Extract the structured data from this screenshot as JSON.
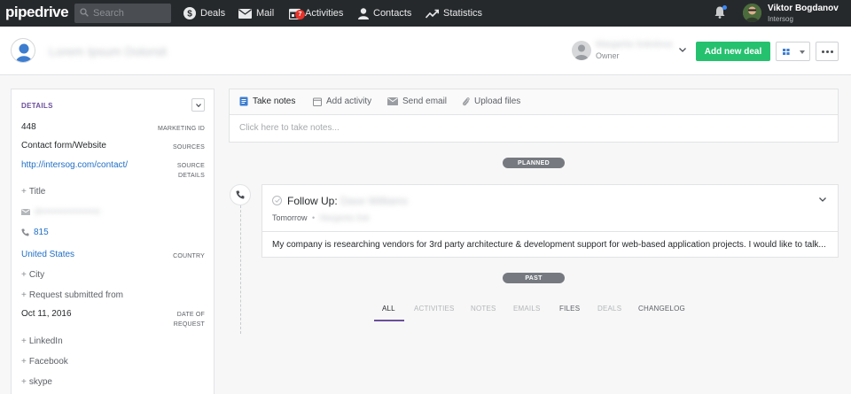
{
  "app": {
    "logo": "pipedrive",
    "search_placeholder": "Search"
  },
  "nav": [
    {
      "label": "Deals",
      "icon": "dollar-icon"
    },
    {
      "label": "Mail",
      "icon": "mail-icon"
    },
    {
      "label": "Activities",
      "icon": "calendar-icon",
      "badge": "7"
    },
    {
      "label": "Contacts",
      "icon": "person-icon"
    },
    {
      "label": "Statistics",
      "icon": "chart-icon"
    }
  ],
  "user": {
    "name": "Viktor Bogdanov",
    "company": "Intersog"
  },
  "header": {
    "person_name": "Lorem Ipsum Dolorsit",
    "owner_name": "Margarita Sokolova",
    "owner_label": "Owner",
    "add_deal_label": "Add new deal"
  },
  "details": {
    "title": "DETAILS",
    "marketing_id": {
      "value": "448",
      "label": "MARKETING ID"
    },
    "sources": {
      "value": "Contact form/Website",
      "label": "SOURCES"
    },
    "source_details": {
      "value": "http://intersog.com/contact/",
      "label_1": "SOURCE",
      "label_2": "DETAILS"
    },
    "title_field": "Title",
    "email_blurred": "d••••••••••••••••••n",
    "phone": "815",
    "country": {
      "value": "United States",
      "label": "COUNTRY"
    },
    "city": "City",
    "request_submitted": "Request submitted from",
    "date": {
      "value": "Oct 11, 2016",
      "label_1": "DATE OF",
      "label_2": "REQUEST"
    },
    "linkedin": "LinkedIn",
    "facebook": "Facebook",
    "skype": "skype"
  },
  "composer": {
    "tabs": [
      "Take notes",
      "Add activity",
      "Send email",
      "Upload files"
    ],
    "placeholder": "Click here to take notes..."
  },
  "timeline": {
    "planned_label": "PLANNED",
    "past_label": "PAST",
    "activity": {
      "title": "Follow Up:",
      "title_blurred": "Dave Williams",
      "when": "Tomorrow",
      "who_blurred": "Margarita Sok",
      "body": "My company is researching vendors for 3rd party architecture & development support for web-based application projects. I would like to talk..."
    },
    "filters": [
      "ALL",
      "ACTIVITIES",
      "NOTES",
      "EMAILS",
      "FILES",
      "DEALS",
      "CHANGELOG"
    ]
  },
  "colors": {
    "accent": "#6a4f9c",
    "primary_button": "#25c16f",
    "nav_bg": "#26292c",
    "link": "#1f6fc5"
  }
}
